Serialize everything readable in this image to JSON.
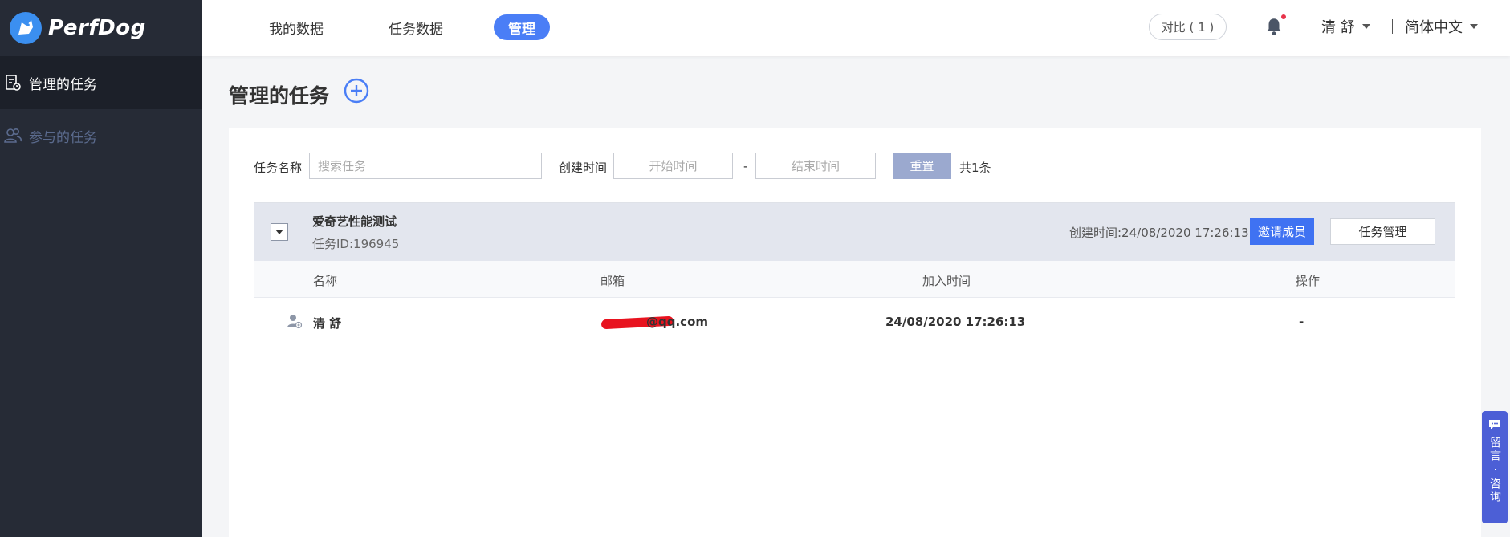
{
  "app": {
    "brand": "PerfDog"
  },
  "sidebar": {
    "items": [
      {
        "label": "管理的任务",
        "active": true
      },
      {
        "label": "参与的任务",
        "active": false
      }
    ]
  },
  "topnav": {
    "tabs": [
      {
        "label": "我的数据"
      },
      {
        "label": "任务数据"
      },
      {
        "label": "管理"
      }
    ],
    "compare_label": "对比 ( 1 )",
    "user_name": "清 舒",
    "language": "简体中文"
  },
  "page": {
    "title": "管理的任务"
  },
  "filters": {
    "name_label": "任务名称",
    "name_placeholder": "搜索任务",
    "created_label": "创建时间",
    "start_placeholder": "开始时间",
    "range_sep": "-",
    "end_placeholder": "结束时间",
    "reset_label": "重置",
    "total_text": "共1条"
  },
  "task": {
    "name": "爱奇艺性能测试",
    "id_text": "任务ID:196945",
    "created_text": "创建时间:24/08/2020 17:26:13",
    "invite_label": "邀请成员",
    "manage_label": "任务管理",
    "columns": [
      "名称",
      "邮箱",
      "加入时间",
      "操作"
    ],
    "members": [
      {
        "name": "清 舒",
        "email": "@qq.com",
        "joined": "24/08/2020 17:26:13",
        "action": "-"
      }
    ]
  },
  "feedback": {
    "label": "留言 · 咨询"
  },
  "colors": {
    "accent": "#4a7ef6",
    "sidebar_bg": "#262b36",
    "redaction": "#e8131f"
  }
}
